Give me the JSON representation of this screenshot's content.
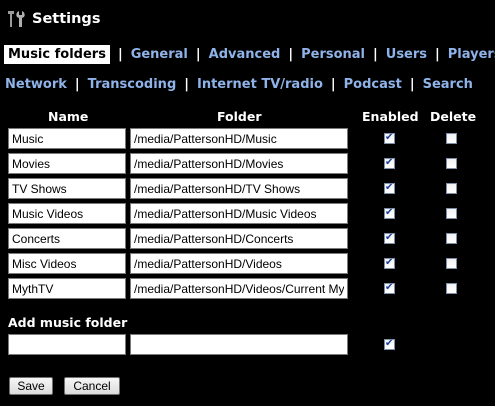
{
  "header": {
    "title": "Settings",
    "icon": "tools-icon"
  },
  "nav": {
    "row1": [
      {
        "label": "Music folders",
        "active": true
      },
      {
        "label": "General",
        "active": false
      },
      {
        "label": "Advanced",
        "active": false
      },
      {
        "label": "Personal",
        "active": false
      },
      {
        "label": "Users",
        "active": false
      },
      {
        "label": "Players",
        "active": false
      }
    ],
    "row2": [
      {
        "label": "Network",
        "active": false
      },
      {
        "label": "Transcoding",
        "active": false
      },
      {
        "label": "Internet TV/radio",
        "active": false
      },
      {
        "label": "Podcast",
        "active": false
      },
      {
        "label": "Search",
        "active": false
      }
    ],
    "separator": "|"
  },
  "table": {
    "columns": {
      "name": "Name",
      "folder": "Folder",
      "enabled": "Enabled",
      "delete": "Delete"
    },
    "rows": [
      {
        "name": "Music",
        "folder": "/media/PattersonHD/Music",
        "enabled": true,
        "delete": false
      },
      {
        "name": "Movies",
        "folder": "/media/PattersonHD/Movies",
        "enabled": true,
        "delete": false
      },
      {
        "name": "TV Shows",
        "folder": "/media/PattersonHD/TV Shows",
        "enabled": true,
        "delete": false
      },
      {
        "name": "Music Videos",
        "folder": "/media/PattersonHD/Music Videos",
        "enabled": true,
        "delete": false
      },
      {
        "name": "Concerts",
        "folder": "/media/PattersonHD/Concerts",
        "enabled": true,
        "delete": false
      },
      {
        "name": "Misc Videos",
        "folder": "/media/PattersonHD/Videos",
        "enabled": true,
        "delete": false
      },
      {
        "name": "MythTV",
        "folder": "/media/PattersonHD/Videos/Current My",
        "enabled": true,
        "delete": false
      }
    ]
  },
  "add_folder": {
    "label": "Add music folder",
    "name_value": "",
    "folder_value": "",
    "enabled": true
  },
  "buttons": {
    "save": "Save",
    "cancel": "Cancel"
  },
  "colors": {
    "background": "#000000",
    "link": "#8fb3e8",
    "text": "#ffffff"
  }
}
